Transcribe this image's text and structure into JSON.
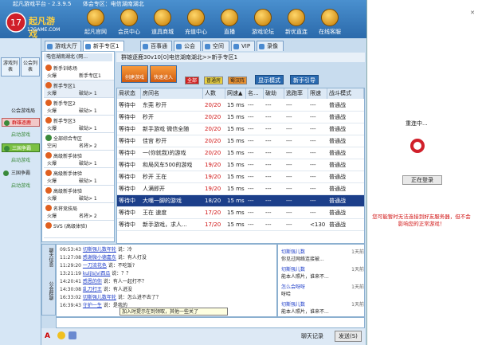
{
  "window": {
    "title": "起凡游戏平台 - 2.3.9.5",
    "subtitle": "体会专区：电信湖南湖北"
  },
  "logo": {
    "name": "起凡游戏",
    "domain": "17GAME.COM"
  },
  "nav": [
    "起凡官网",
    "会员中心",
    "道具商城",
    "充值中心",
    "直播",
    "游戏论坛",
    "新优直连",
    "在线客服"
  ],
  "tabs": [
    "游戏大厅",
    "新手专区1",
    "百事通",
    "公会",
    "空间",
    "VIP",
    "录像"
  ],
  "sidebar": {
    "tabs": [
      "游戏列表",
      "公会列表"
    ],
    "items": [
      "公会游戏局",
      "群雄逐鹿",
      "启动游戏",
      "三国争霸",
      "启动游戏",
      "三国争霸",
      "启动游戏"
    ]
  },
  "roomlist": {
    "header": "电信湖南湖北 (网...",
    "rooms": [
      {
        "name": "新手训练场",
        "l": "火爆",
        "r": "新手专区1"
      },
      {
        "name": "新手专区1",
        "l": "火爆",
        "r": "破劫> 1"
      },
      {
        "name": "新手专区2",
        "l": "火爆",
        "r": "破劫> 1"
      },
      {
        "name": "新手专区3",
        "l": "火爆",
        "r": "破劫> 1"
      },
      {
        "name": "全部综合专区",
        "l": "空闲",
        "r": "名将> 2"
      },
      {
        "name": "高级新手体验",
        "l": "火爆",
        "r": "破劫> 1"
      },
      {
        "name": "高级新手体验",
        "l": "火爆",
        "r": "破劫> 1"
      },
      {
        "name": "高级新手体验",
        "l": "火爆",
        "r": "破劫> 1"
      },
      {
        "name": "名将竞技局",
        "l": "火爆",
        "r": "名将> 2"
      },
      {
        "name": "SVS (高级体验)",
        "l": "",
        "r": ""
      }
    ]
  },
  "room_title": "群雄逐鹿30v10[0]电信湖南湖北>>新手专区1",
  "toolbar": {
    "create": "创建游戏",
    "quick": "快速进入",
    "filters": [
      "全部",
      "普通房",
      "蜀汉阵"
    ],
    "display_mode": "显示模式",
    "guide": "新手引导"
  },
  "table": {
    "columns": [
      "局状态",
      "房间名",
      "人数",
      "网速▲",
      "名...",
      "破劫",
      "逃跑率",
      "限速",
      "战斗模式"
    ],
    "rows": [
      [
        "等待中",
        "东莞 秒开",
        "20/20",
        "15 ms",
        "---",
        "---",
        "---",
        "---",
        "普通战"
      ],
      [
        "等待中",
        "秒开",
        "20/20",
        "15 ms",
        "---",
        "---",
        "---",
        "---",
        "普通战"
      ],
      [
        "等待中",
        "新手游戏 微信全随",
        "20/20",
        "15 ms",
        "---",
        "---",
        "---",
        "---",
        "普通战"
      ],
      [
        "等待中",
        "佳宫 秒开",
        "20/20",
        "15 ms",
        "---",
        "---",
        "---",
        "---",
        "普通战"
      ],
      [
        "等待中",
        "一(你就我)的游戏",
        "20/20",
        "15 ms",
        "---",
        "---",
        "---",
        "---",
        "普通战"
      ],
      [
        "等待中",
        "和局风车500的游戏",
        "19/20",
        "15 ms",
        "---",
        "---",
        "---",
        "---",
        "普通战"
      ],
      [
        "等待中",
        "秒开 王在",
        "19/20",
        "15 ms",
        "---",
        "---",
        "---",
        "---",
        "普通战"
      ],
      [
        "等待中",
        "人满即开",
        "19/20",
        "15 ms",
        "---",
        "---",
        "---",
        "---",
        "普通战"
      ],
      [
        "等待中",
        "大嘴一脚的游戏",
        "18/20",
        "15 ms",
        "---",
        "---",
        "---",
        "---",
        "普通战"
      ],
      [
        "等待中",
        "王在 速度",
        "17/20",
        "15 ms",
        "---",
        "---",
        "---",
        "---",
        "普通战"
      ],
      [
        "等待中",
        "新手游戏，求人...",
        "17/20",
        "15 ms",
        "---",
        "---",
        "---",
        "<130",
        "普通战"
      ]
    ],
    "selected_index": 8
  },
  "chat": {
    "sidetabs": [
      "聊天信息",
      "公会群聊"
    ],
    "messages": [
      {
        "t": "09:53:43",
        "u": "切斯强儿数年轮",
        "m": "说：冷"
      },
      {
        "t": "11:27:08",
        "u": "感谢微小德嘉东",
        "m": "说：有人打没"
      },
      {
        "t": "11:29:20",
        "u": "一刀流花色",
        "m": "说：不吃饭?"
      },
      {
        "t": "13:21:19",
        "u": "kuljls|vi西瓜",
        "m": "说：？？"
      },
      {
        "t": "14:20:41",
        "u": "感恩的你",
        "m": "说：有人一起打不？"
      },
      {
        "t": "14:30:08",
        "u": "乱刀打王",
        "m": "说：有人进没"
      },
      {
        "t": "16:33:02",
        "u": "切斯强儿数年轮",
        "m": "说：怎么进不去了？"
      },
      {
        "t": "16:39:43",
        "u": "守护一生",
        "m": "说：是我的"
      }
    ],
    "tooltip": "加入时提示在到领取，其他一些关了"
  },
  "announce": [
    {
      "u": "切斯强儿数",
      "d": "1天前",
      "m": "你见过网络连接被..."
    },
    {
      "u": "切斯强儿数",
      "d": "1天前",
      "m": "能本人照片，谁来不..."
    },
    {
      "u": "怎么会呀呀",
      "d": "1天前",
      "m": "呀哈"
    },
    {
      "u": "切斯强儿数",
      "d": "1天前",
      "m": "能本人照片，谁来不..."
    }
  ],
  "right_pane": {
    "status": "重连中...",
    "button": "正在登录",
    "error": "您可能暂时无法连接到好友服务器，但不会影响您的正常游戏！"
  },
  "bottom": {
    "chat_record": "聊天记录",
    "send": "发送(S)"
  }
}
